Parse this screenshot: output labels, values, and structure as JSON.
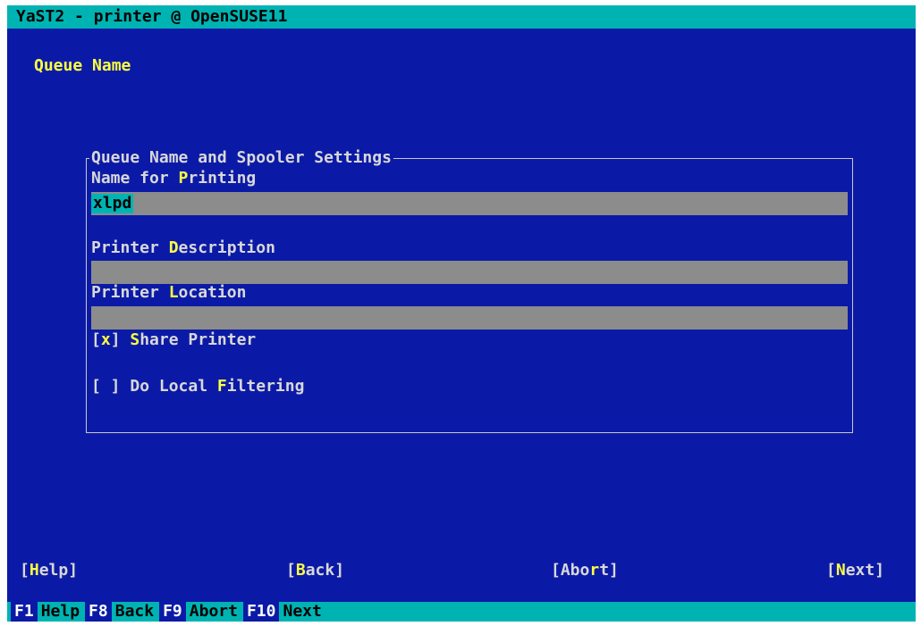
{
  "window": {
    "title": "YaST2 - printer @ OpenSUSE11"
  },
  "heading": "Queue Name",
  "frame": {
    "title": "Queue Name and Spooler Settings"
  },
  "fields": {
    "name": {
      "pre": "Name for ",
      "hot": "P",
      "post": "rinting",
      "value": "xlpd"
    },
    "description": {
      "pre": "Printer ",
      "hot": "D",
      "post": "escription",
      "value": ""
    },
    "location": {
      "pre": "Printer ",
      "hot": "L",
      "post": "ocation",
      "value": ""
    }
  },
  "checkboxes": {
    "share": {
      "box": "[x]",
      "mark": "x",
      "hot": "S",
      "post": "hare Printer",
      "checked": true
    },
    "filtering": {
      "box": "[ ]",
      "pre": "Do Local ",
      "hot": "F",
      "post": "iltering",
      "checked": false
    }
  },
  "buttons": {
    "help": {
      "open": "[",
      "hot": "H",
      "post": "elp]"
    },
    "back": {
      "open": "[",
      "hot": "B",
      "post": "ack]"
    },
    "abort": {
      "pre": "[Abo",
      "hot": "r",
      "post": "t]"
    },
    "next": {
      "open": "[",
      "hot": "N",
      "post": "ext]"
    }
  },
  "fkeys": [
    {
      "key": "F1",
      "label": "Help"
    },
    {
      "key": "F8",
      "label": "Back"
    },
    {
      "key": "F9",
      "label": "Abort"
    },
    {
      "key": "F10",
      "label": "Next"
    }
  ],
  "colors": {
    "background": "#0b1aa6",
    "bar": "#00b3b3",
    "hotkey": "#ffff40",
    "field": "#8c8c8c"
  }
}
